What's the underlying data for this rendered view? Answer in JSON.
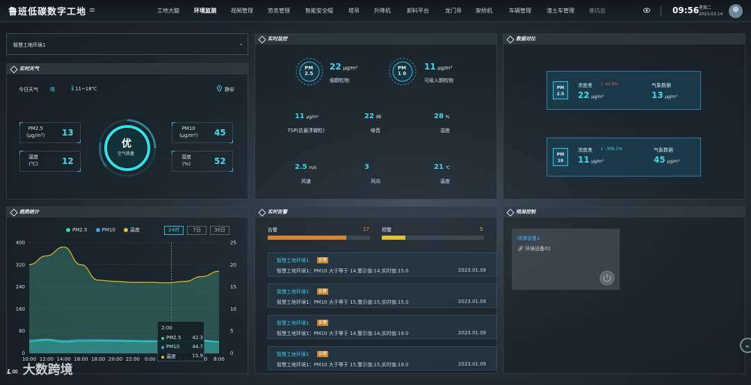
{
  "header": {
    "title": "鲁班低碳数字工地",
    "nav": [
      "工地大脑",
      "环境监测",
      "视频管理",
      "劳务管理",
      "智能安全帽",
      "塔吊",
      "升降机",
      "卸料平台",
      "龙门吊",
      "架桥机",
      "车辆管理",
      "渣土车管理",
      "基坑监"
    ],
    "active_nav": 1,
    "time": "09:56",
    "weekday": "星期二",
    "date": "2023.03.14"
  },
  "selector": {
    "value": "智慧工地环境1"
  },
  "weather": {
    "title": "实时天气",
    "today_label": "今日天气",
    "condition": "晴",
    "temp_range": "11~18℃",
    "location": "静安",
    "aqi_grade": "优",
    "aqi_label": "空气质量",
    "items": [
      {
        "label": "PM2.5",
        "unit": "(μg/m³)",
        "value": "13"
      },
      {
        "label": "PM10",
        "unit": "(μg/m³)",
        "value": "45"
      },
      {
        "label": "温度",
        "unit": "(℃)",
        "value": "12"
      },
      {
        "label": "湿度",
        "unit": "(%)",
        "value": "52"
      }
    ]
  },
  "monitor": {
    "title": "实时监控",
    "pm25": {
      "badge_top": "PM",
      "badge_bottom": "2.5",
      "value": "22",
      "unit": "μg/m³",
      "label": "细颗粒物"
    },
    "pm10": {
      "badge_top": "PM",
      "badge_bottom": "1 0",
      "value": "11",
      "unit": "μg/m³",
      "label": "可吸入颗粒物"
    },
    "grid": [
      {
        "value": "11",
        "unit": "μg/m³",
        "label": "TSP(总悬浮微粒)"
      },
      {
        "value": "22",
        "unit": "dB",
        "label": "噪音"
      },
      {
        "value": "28",
        "unit": "%",
        "label": "湿度"
      },
      {
        "value": "2.5",
        "unit": "m/s",
        "label": "风速"
      },
      {
        "value": "3",
        "unit": "",
        "label": "风向"
      },
      {
        "value": "21",
        "unit": "℃",
        "label": "温度"
      }
    ]
  },
  "compare": {
    "title": "数据对比",
    "cards": [
      {
        "badge_top": "PM",
        "badge_bottom": "2.5",
        "diff_label": "浓度差",
        "change": "40.9%",
        "change_dir": "up",
        "value": "22",
        "unit": "μg/m³",
        "ref_label": "气象数据",
        "ref_value": "13",
        "ref_unit": "μg/m³"
      },
      {
        "badge_top": "PM",
        "badge_bottom": "10",
        "diff_label": "浓度差",
        "change": "-309.1%",
        "change_dir": "down",
        "value": "11",
        "unit": "μg/m³",
        "ref_label": "气象数据",
        "ref_value": "45",
        "ref_unit": "μg/m³"
      }
    ]
  },
  "trend": {
    "title": "趋势统计",
    "ranges": [
      "24时",
      "7日",
      "30日"
    ],
    "active_range": 0,
    "tooltip": {
      "time": "2:00",
      "rows": [
        {
          "name": "PM2.5",
          "value": "42.3",
          "color": "#2fe0a8"
        },
        {
          "name": "PM10",
          "value": "44.7",
          "color": "#3fa6f0"
        },
        {
          "name": "温度",
          "value": "15.9",
          "color": "#e0c12f"
        }
      ]
    }
  },
  "chart_data": {
    "type": "area",
    "x": [
      "10:00",
      "12:00",
      "14:00",
      "16:00",
      "18:00",
      "20:00",
      "22:00",
      "0:00",
      "2:00",
      "4:00",
      "6:00",
      "8:00"
    ],
    "series": [
      {
        "name": "PM2.5",
        "axis": "left",
        "color": "#2fe0a8",
        "values": [
          42,
          47,
          40,
          43,
          44,
          43,
          42,
          41,
          42.3,
          43,
          44,
          40
        ]
      },
      {
        "name": "PM10",
        "axis": "left",
        "color": "#3fa6f0",
        "values": [
          47,
          50,
          45,
          48,
          48,
          47,
          46,
          45,
          44.7,
          46,
          47,
          42
        ]
      },
      {
        "name": "温度",
        "axis": "right",
        "color": "#e0c12f",
        "values": [
          20,
          22,
          24,
          20,
          16.5,
          16.2,
          16,
          16,
          15.9,
          16.2,
          17.3,
          18.5
        ]
      }
    ],
    "ylim_left": [
      0,
      400
    ],
    "yticks_left": [
      0,
      80,
      160,
      240,
      320,
      400
    ],
    "ylim_right": [
      0,
      25
    ],
    "yticks_right": [
      0,
      5,
      10,
      15,
      20,
      25
    ],
    "legend": "top"
  },
  "alerts": {
    "title": "实时告警",
    "alarm_label": "告警",
    "alarm_count": "17",
    "alarm_ratio": 0.77,
    "warn_label": "预警",
    "warn_count": "5",
    "warn_ratio": 0.23,
    "list": [
      {
        "source": "智慧工地环境1",
        "tag": "告警",
        "detail": "智慧工地环境1：PM10 大于等于 14,警示值:14,实时值:15.0",
        "date": "2023.01.09"
      },
      {
        "source": "智慧工地环境1",
        "tag": "告警",
        "detail": "智慧工地环境1：PM10 大于等于 15,警示值:15,实时值:15.0",
        "date": "2023.01.09"
      },
      {
        "source": "智慧工地环境1",
        "tag": "告警",
        "detail": "智慧工地环境1：PM10 大于等于 14,警示值:14,实时值:19.0",
        "date": "2023.01.09"
      },
      {
        "source": "智慧工地环境1",
        "tag": "告警",
        "detail": "智慧工地环境1：PM10 大于等于 15,警示值:15,实时值:19.0",
        "date": "2023.01.09"
      }
    ]
  },
  "spray": {
    "title": "喷淋控制",
    "device_name": "喷淋设备1",
    "device_link": "环境设备01"
  },
  "watermark": "大数跨境"
}
